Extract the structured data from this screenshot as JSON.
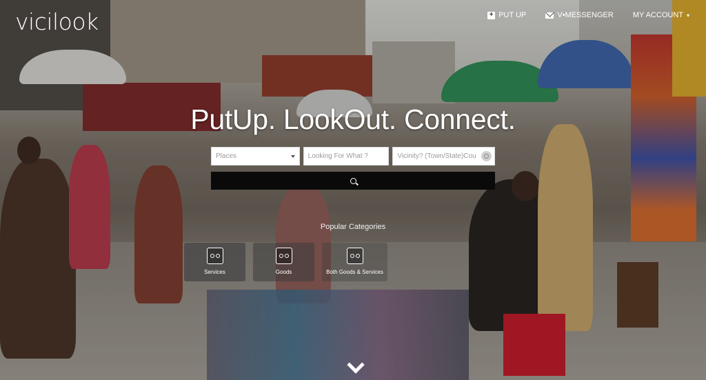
{
  "brand": {
    "logo_text": "vicilook"
  },
  "nav": {
    "put_up": "PUT UP",
    "messenger": "V•MESSENGER",
    "account": "MY ACCOUNT"
  },
  "hero": {
    "headline": "PutUp. LookOut. Connect."
  },
  "search": {
    "places_placeholder": "Places",
    "what_placeholder": "Looking For What ?",
    "vicinity_placeholder": "Vicinity? (Town/State)Cou"
  },
  "categories": {
    "heading": "Popular Categories",
    "items": [
      {
        "label": "Services",
        "icon": "double-eye-icon"
      },
      {
        "label": "Goods",
        "icon": "double-eye-icon"
      },
      {
        "label": "Both Goods & Services",
        "icon": "double-eye-icon"
      }
    ]
  },
  "icons": {
    "put_up": "plus-square-icon",
    "messenger": "envelope-icon",
    "account": "caret-down-icon",
    "locate": "locate-icon",
    "search": "search-icon",
    "scroll": "chevron-down-icon"
  },
  "colors": {
    "search_button": "#0a0a0a",
    "text": "#ffffff"
  }
}
